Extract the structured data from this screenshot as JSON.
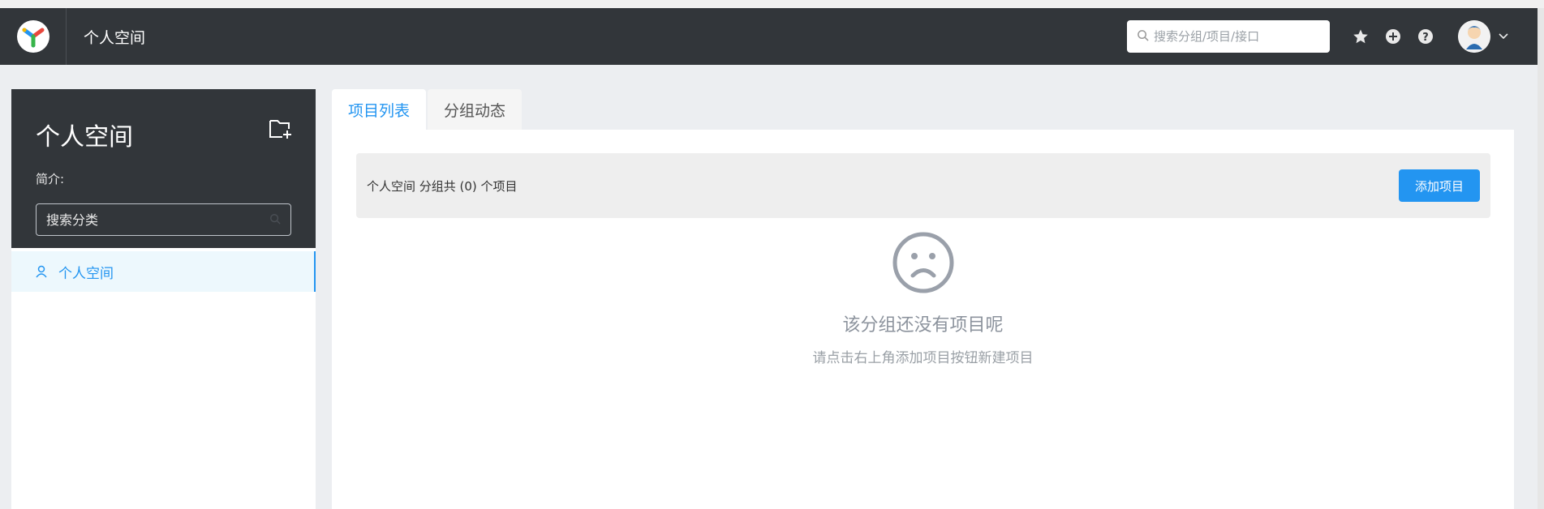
{
  "header": {
    "title": "个人空间",
    "search_placeholder": "搜索分组/项目/接口",
    "icons": [
      "star-icon",
      "plus-circle-icon",
      "question-icon",
      "avatar",
      "chevron-down-icon"
    ]
  },
  "sidebar": {
    "title": "个人空间",
    "intro_label": "简介:",
    "search_placeholder": "搜索分类",
    "groups": [
      {
        "label": "个人空间",
        "icon": "user-icon",
        "active": true
      }
    ]
  },
  "tabs": [
    {
      "label": "项目列表",
      "active": true
    },
    {
      "label": "分组动态",
      "active": false
    }
  ],
  "main": {
    "summary": "个人空间 分组共 (0) 个项目",
    "add_button_label": "添加项目",
    "empty_title": "该分组还没有项目呢",
    "empty_desc": "请点击右上角添加项目按钮新建项目"
  },
  "colors": {
    "header_bg": "#32363a",
    "accent": "#2395f1",
    "page_bg": "#eceef1"
  }
}
